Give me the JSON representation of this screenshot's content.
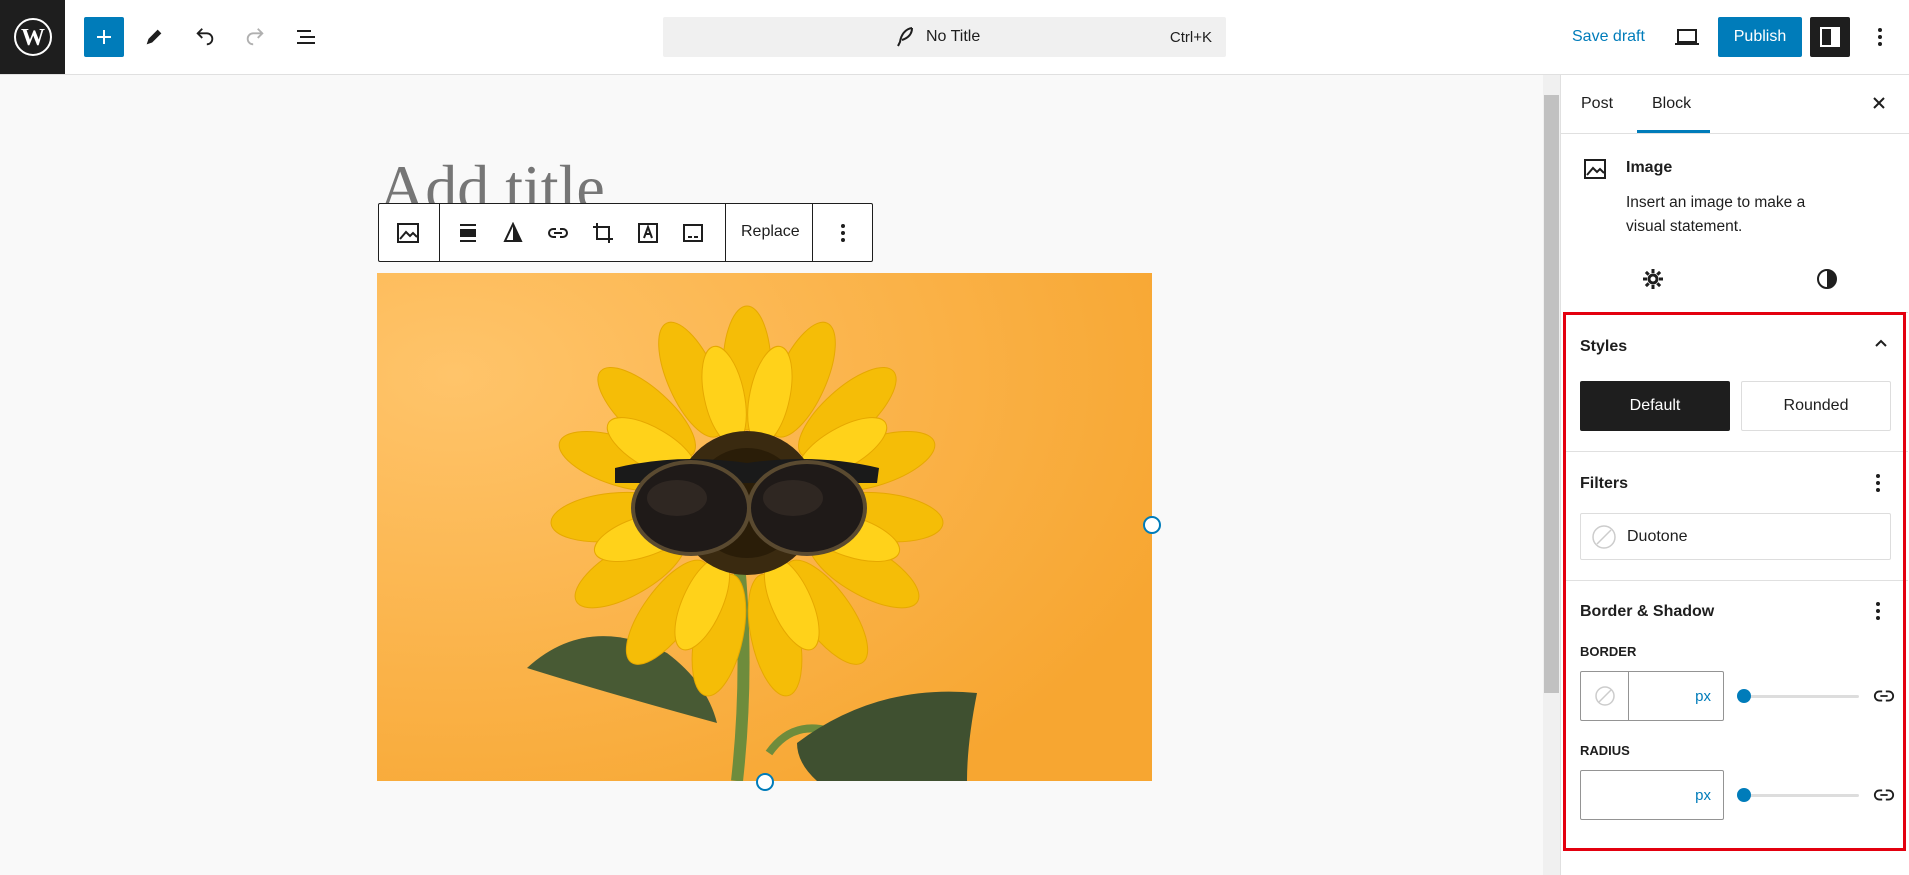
{
  "topbar": {
    "document_title": "No Title",
    "shortcut": "Ctrl+K",
    "save_draft": "Save draft",
    "publish": "Publish"
  },
  "editor": {
    "title_placeholder": "Add title",
    "toolbar_replace": "Replace",
    "image_alt": "Sunflower with sunglasses on orange background"
  },
  "sidebar": {
    "tabs": [
      "Post",
      "Block"
    ],
    "active_tab": "Block",
    "block": {
      "name": "Image",
      "description": "Insert an image to make a visual statement."
    },
    "styles": {
      "title": "Styles",
      "options": [
        "Default",
        "Rounded"
      ],
      "selected": "Default"
    },
    "filters": {
      "title": "Filters",
      "duotone": "Duotone"
    },
    "border_shadow": {
      "title": "Border & Shadow",
      "border_label": "BORDER",
      "border_unit": "px",
      "border_value": "",
      "radius_label": "RADIUS",
      "radius_unit": "px",
      "radius_value": ""
    }
  },
  "colors": {
    "accent": "#007cba",
    "highlight": "#e3000f",
    "dark": "#1e1e1e"
  }
}
